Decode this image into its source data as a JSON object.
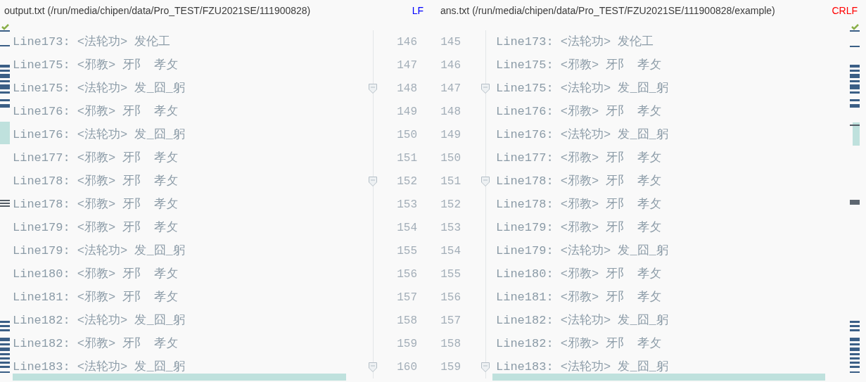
{
  "panels": [
    {
      "title": "output.txt (/run/media/chipen/data/Pro_TEST/FZU2021SE/111900828)",
      "line_ending": "LF",
      "color": "#0000ff"
    },
    {
      "title": "ans.txt (/run/media/chipen/data/Pro_TEST/FZU2021SE/111900828/example)",
      "line_ending": "CRLF",
      "color": "#ff0000"
    }
  ],
  "rows": [
    {
      "left_text": "Line173: <法轮功> 发伦工",
      "left_number": "146",
      "right_number": "145",
      "right_text": "Line173: <法轮功> 发伦工",
      "fold": false
    },
    {
      "left_text": "Line175: <邪教> 牙阝 孝攵",
      "left_number": "147",
      "right_number": "146",
      "right_text": "Line175: <邪教> 牙阝 孝攵",
      "fold": false
    },
    {
      "left_text": "Line175: <法轮功> 发_囧_躬",
      "left_number": "148",
      "right_number": "147",
      "right_text": "Line175: <法轮功> 发_囧_躬",
      "fold": true
    },
    {
      "left_text": "Line176: <邪教> 牙阝 孝攵",
      "left_number": "149",
      "right_number": "148",
      "right_text": "Line176: <邪教> 牙阝 孝攵",
      "fold": false
    },
    {
      "left_text": "Line176: <法轮功> 发_囧_躬",
      "left_number": "150",
      "right_number": "149",
      "right_text": "Line176: <法轮功> 发_囧_躬",
      "fold": false
    },
    {
      "left_text": "Line177: <邪教> 牙阝 孝攵",
      "left_number": "151",
      "right_number": "150",
      "right_text": "Line177: <邪教> 牙阝 孝攵",
      "fold": false
    },
    {
      "left_text": "Line178: <邪教> 牙阝 孝攵",
      "left_number": "152",
      "right_number": "151",
      "right_text": "Line178: <邪教> 牙阝 孝攵",
      "fold": true
    },
    {
      "left_text": "Line178: <邪教> 牙阝 孝攵",
      "left_number": "153",
      "right_number": "152",
      "right_text": "Line178: <邪教> 牙阝 孝攵",
      "fold": false
    },
    {
      "left_text": "Line179: <邪教> 牙阝 孝攵",
      "left_number": "154",
      "right_number": "153",
      "right_text": "Line179: <邪教> 牙阝 孝攵",
      "fold": false
    },
    {
      "left_text": "Line179: <法轮功> 发_囧_躬",
      "left_number": "155",
      "right_number": "154",
      "right_text": "Line179: <法轮功> 发_囧_躬",
      "fold": false
    },
    {
      "left_text": "Line180: <邪教> 牙阝 孝攵",
      "left_number": "156",
      "right_number": "155",
      "right_text": "Line180: <邪教> 牙阝 孝攵",
      "fold": false
    },
    {
      "left_text": "Line181: <邪教> 牙阝 孝攵",
      "left_number": "157",
      "right_number": "156",
      "right_text": "Line181: <邪教> 牙阝 孝攵",
      "fold": false
    },
    {
      "left_text": "Line182: <法轮功> 发_囧_躬",
      "left_number": "158",
      "right_number": "157",
      "right_text": "Line182: <法轮功> 发_囧_躬",
      "fold": false
    },
    {
      "left_text": "Line182: <邪教> 牙阝 孝攵",
      "left_number": "159",
      "right_number": "158",
      "right_text": "Line182: <邪教> 牙阝 孝攵",
      "fold": false
    },
    {
      "left_text": "Line183: <法轮功> 发_囧_躬",
      "left_number": "160",
      "right_number": "159",
      "right_text": "Line183: <法轮功> 发_囧_躬",
      "fold": true
    }
  ]
}
